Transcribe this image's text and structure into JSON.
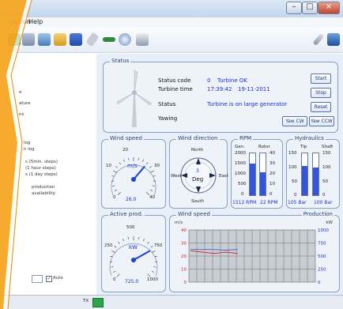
{
  "menu": {
    "items": [
      "...uation",
      "Help"
    ]
  },
  "toolbar": {
    "icons": [
      "print-icon",
      "print-preview-icon",
      "clipboard-icon",
      "save-icon",
      "pen-icon",
      "battery-icon",
      "cable-icon",
      "gauge-icon",
      "wrench-icon",
      "monitor-icon"
    ]
  },
  "tree": {
    "items": [
      "e",
      "ature",
      "ns",
      "log",
      "n log",
      "s (5min. steps)",
      "(1 hour steps)",
      "s (1 day steps)",
      "production",
      "availability"
    ],
    "auto_label": "Auto"
  },
  "status": {
    "title": "Status",
    "code_label": "Status code",
    "code_value": "0",
    "code_text": "Turbine OK",
    "time_label": "Turbine time",
    "time_value": "17:39:42",
    "date_value": "19-11-2011",
    "status_label": "Status",
    "status_text": "Turbine is on large generator",
    "yawing_label": "Yawing",
    "btn_start": "Start",
    "btn_stop": "Stop",
    "btn_reset": "Reset",
    "btn_yaw_cw": "Yaw CW",
    "btn_yaw_ccw": "Yaw CCW"
  },
  "wind_speed": {
    "title": "Wind speed",
    "unit": "m/s",
    "value": "26.0",
    "needle": 26,
    "ticks": [
      "0",
      "10",
      "20",
      "30",
      "40"
    ]
  },
  "wind_direction": {
    "title": "Wind direction",
    "north": "North",
    "south": "South",
    "east": "East",
    "west": "West",
    "value": "3",
    "unit": "Deg"
  },
  "rpm": {
    "title": "RPM",
    "gen_label": "Gen.",
    "rotor_label": "Rotor",
    "gen_ticks": [
      "2000",
      "1500",
      "1000",
      "500",
      "0"
    ],
    "rotor_ticks": [
      "40",
      "30",
      "20",
      "10",
      "0"
    ],
    "gen_value": "1512 RPM",
    "rotor_value": "22 RPM",
    "gen_level": 0.756,
    "rotor_level": 0.55
  },
  "hydraulics": {
    "title": "Hydraulics",
    "tip_label": "Tip",
    "shaft_label": "Shaft",
    "ticks": [
      "150",
      "100",
      "50",
      "0"
    ],
    "tip_value": "105 Bar",
    "shaft_value": "100 Bar",
    "tip_level": 0.7,
    "shaft_level": 0.667
  },
  "active_prod": {
    "title": "Active prod.",
    "unit": "kW",
    "value": "725.0",
    "needle": 725,
    "ticks": [
      "0",
      "250",
      "500",
      "750",
      "1000"
    ]
  },
  "trend": {
    "title_left": "Wind speed",
    "unit_left": "m/s",
    "title_right": "Production",
    "unit_right": "kW",
    "left_ticks": [
      "40",
      "30",
      "20",
      "10",
      "0"
    ],
    "right_ticks": [
      "1000",
      "750",
      "500",
      "250",
      "0"
    ]
  },
  "statusbar": {
    "text": "TX"
  },
  "colors": {
    "accent": "#1a2fd0",
    "bar": "#3355dd",
    "orange": "#f5a623"
  },
  "chart_data": {
    "type": "line",
    "series": [
      {
        "name": "",
        "values": [
          25,
          25,
          25,
          24.5,
          25
        ]
      },
      {
        "name": "",
        "values": [
          24,
          23,
          22,
          23,
          22
        ]
      }
    ],
    "ylim": [
      0,
      40
    ],
    "ylim_right": [
      0,
      1000
    ]
  }
}
